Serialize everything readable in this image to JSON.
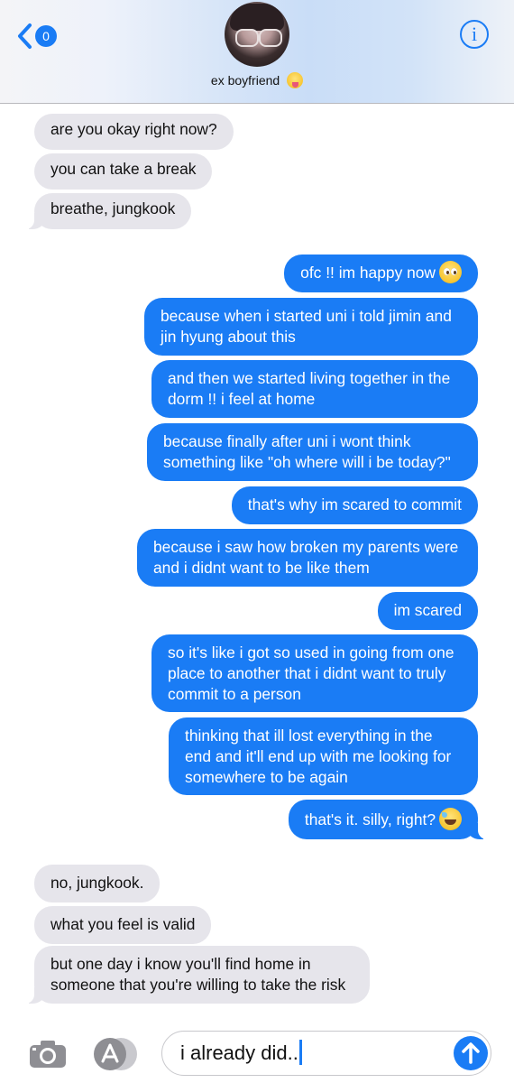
{
  "header": {
    "back_count": "0",
    "contact_name": "ex boyfriend",
    "info_glyph": "i",
    "contact_emoji": "zany-face-icon"
  },
  "colors": {
    "sent_bubble": "#1a7cf5",
    "received_bubble": "#e6e5eb",
    "accent": "#1a7cf5"
  },
  "messages": [
    {
      "dir": "received",
      "text": "are you okay right now?"
    },
    {
      "dir": "received",
      "text": "you can take a break"
    },
    {
      "dir": "received",
      "text": "breathe, jungkook"
    },
    {
      "dir": "sent",
      "text": "ofc !! im happy now",
      "emoji": "pleading-face-icon"
    },
    {
      "dir": "sent",
      "text": "because when i started uni i told jimin and\njin hyung about this"
    },
    {
      "dir": "sent",
      "text": "and then we started living together in the\ndorm !! i feel at home"
    },
    {
      "dir": "sent",
      "text": "because finally after uni i wont think\nsomething like \"oh where will i be today?\""
    },
    {
      "dir": "sent",
      "text": "that's why im scared to commit"
    },
    {
      "dir": "sent",
      "text": "because i saw how broken my parents were\nand i didnt want to be like them"
    },
    {
      "dir": "sent",
      "text": "im scared"
    },
    {
      "dir": "sent",
      "text": "so it's like i got so used in going from one\nplace to another that i didnt want to truly\ncommit to a person"
    },
    {
      "dir": "sent",
      "text": "thinking that ill lost everything in the\nend and it'll end up with me looking for\nsomewhere to be again"
    },
    {
      "dir": "sent",
      "text": "that's it. silly, right?",
      "emoji": "rolling-laughing-face-icon"
    },
    {
      "dir": "received",
      "text": "no, jungkook."
    },
    {
      "dir": "received",
      "text": "what you feel is valid"
    },
    {
      "dir": "received",
      "text": "but one day i know you'll find home in\nsomeone that you're willing to take the risk"
    }
  ],
  "composer": {
    "value": "i already did..",
    "camera_icon": "camera-icon",
    "apps_icon": "app-store-icon",
    "send_icon": "send-arrow-icon"
  }
}
